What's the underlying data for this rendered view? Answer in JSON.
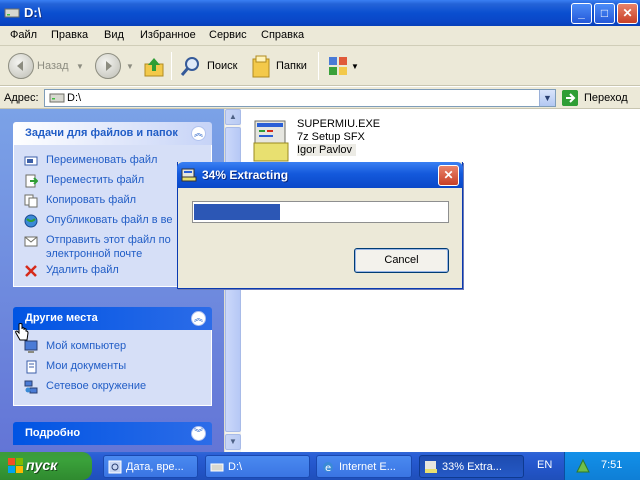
{
  "window": {
    "title": "D:\\",
    "buttons": {
      "minimize": "_",
      "maximize": "□",
      "close": "✕"
    }
  },
  "menu": [
    "Файл",
    "Правка",
    "Вид",
    "Избранное",
    "Сервис",
    "Справка"
  ],
  "toolbar": {
    "back_label": "Назад",
    "search_label": "Поиск",
    "folders_label": "Папки"
  },
  "address": {
    "label": "Адрес:",
    "value": "D:\\",
    "go_label": "Переход"
  },
  "left_panel": {
    "tasks_group": {
      "title": "Задачи для файлов и папок",
      "items": [
        {
          "label": "Переименовать файл",
          "icon": "rename-icon"
        },
        {
          "label": "Переместить файл",
          "icon": "move-icon"
        },
        {
          "label": "Копировать файл",
          "icon": "copy-icon"
        },
        {
          "label": "Опубликовать файл в ве",
          "icon": "publish-icon"
        },
        {
          "label": "Отправить этот файл по",
          "label2": "электронной почте",
          "icon": "email-icon"
        },
        {
          "label": "Удалить файл",
          "icon": "delete-icon"
        }
      ]
    },
    "places_group": {
      "title": "Другие места",
      "items": [
        {
          "label": "Мой компьютер",
          "icon": "my-computer-icon"
        },
        {
          "label": "Мои документы",
          "icon": "my-documents-icon"
        },
        {
          "label": "Сетевое окружение",
          "icon": "network-icon"
        }
      ]
    },
    "details_group": {
      "title": "Подробно"
    }
  },
  "file": {
    "name": "SUPERMIU.EXE",
    "description": "7z Setup SFX",
    "author": "Igor Pavlov"
  },
  "dialog": {
    "title": "34% Extracting",
    "progress": 0.34,
    "cancel_label": "Cancel"
  },
  "taskbar": {
    "start_label": "пуск",
    "tasks": [
      {
        "label": "Дата, вре...",
        "active": false
      },
      {
        "label": "D:\\",
        "active": false
      },
      {
        "label": "Internet E...",
        "active": false
      },
      {
        "label": "33% Extra...",
        "active": true
      }
    ],
    "language": "EN",
    "clock": "7:51"
  },
  "colors": {
    "title_bar": "#0a4fd0",
    "task_link": "#215dc6",
    "progress_fill": "#2c57b5",
    "start_button": "#3aa13a"
  }
}
